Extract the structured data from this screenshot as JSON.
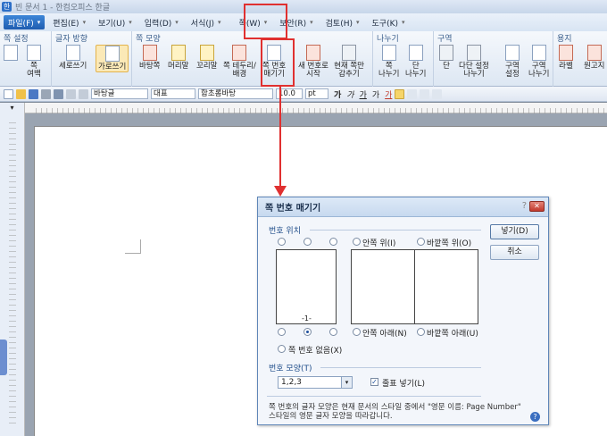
{
  "window": {
    "title": "빈 문서 1 - 한컴오피스 한글"
  },
  "menu": [
    {
      "label": "파일(F)",
      "active": true
    },
    {
      "label": "편집(E)"
    },
    {
      "label": "보기(U)"
    },
    {
      "label": "입력(D)"
    },
    {
      "label": "서식(J)"
    },
    {
      "label": "쪽(W)"
    },
    {
      "label": "보안(R)"
    },
    {
      "label": "검토(H)"
    },
    {
      "label": "도구(K)"
    }
  ],
  "ribbon": {
    "groups": [
      {
        "title": "쪽 설정",
        "buttons": [
          "쪽\n여백"
        ]
      },
      {
        "title": "글자 방향",
        "buttons": [
          "세로쓰기",
          "가로쓰기"
        ]
      },
      {
        "title": "쪽 모양",
        "buttons": [
          "바탕쪽",
          "머리말",
          "꼬리말",
          "쪽 테두리/\n배경",
          "쪽 번호\n매기기",
          "새 번호로\n시작",
          "현재 쪽만\n감추기"
        ]
      },
      {
        "title": "나누기",
        "buttons": [
          "쪽\n나누기",
          "단\n나누기"
        ]
      },
      {
        "title": "구역",
        "buttons": [
          "단",
          "다단 설정\n나누기",
          "구역\n설정",
          "구역\n나누기"
        ]
      },
      {
        "title": "용지",
        "buttons": [
          "라벨",
          "원고지"
        ]
      }
    ]
  },
  "toolbar": {
    "style": "바탕글",
    "lang": "대표",
    "font": "함초롬바탕",
    "size": "10.0",
    "unit": "pt",
    "format_buttons": [
      "가",
      "가",
      "가",
      "가",
      "가"
    ]
  },
  "dialog": {
    "title": "쪽 번호 매기기",
    "position_label": "번호 위치",
    "inner_top": "안쪽 위(I)",
    "outer_top": "바깥쪽 위(O)",
    "inner_bottom": "안쪽 아래(N)",
    "outer_bottom": "바깥쪽 아래(U)",
    "no_number": "쪽 번호 없음(X)",
    "preview_number": "-1-",
    "shape_label": "번호 모양(T)",
    "shape_value": "1,2,3",
    "show_bar": "줄표 넣기(L)",
    "insert_button": "넣기(D)",
    "cancel_button": "취소",
    "note": "쪽 번호의 글자 모양은 현재 문서의 스타일 중에서 \"영문 이름: Page Number\" 스타일의 영문 글자 모양을 따라갑니다."
  }
}
